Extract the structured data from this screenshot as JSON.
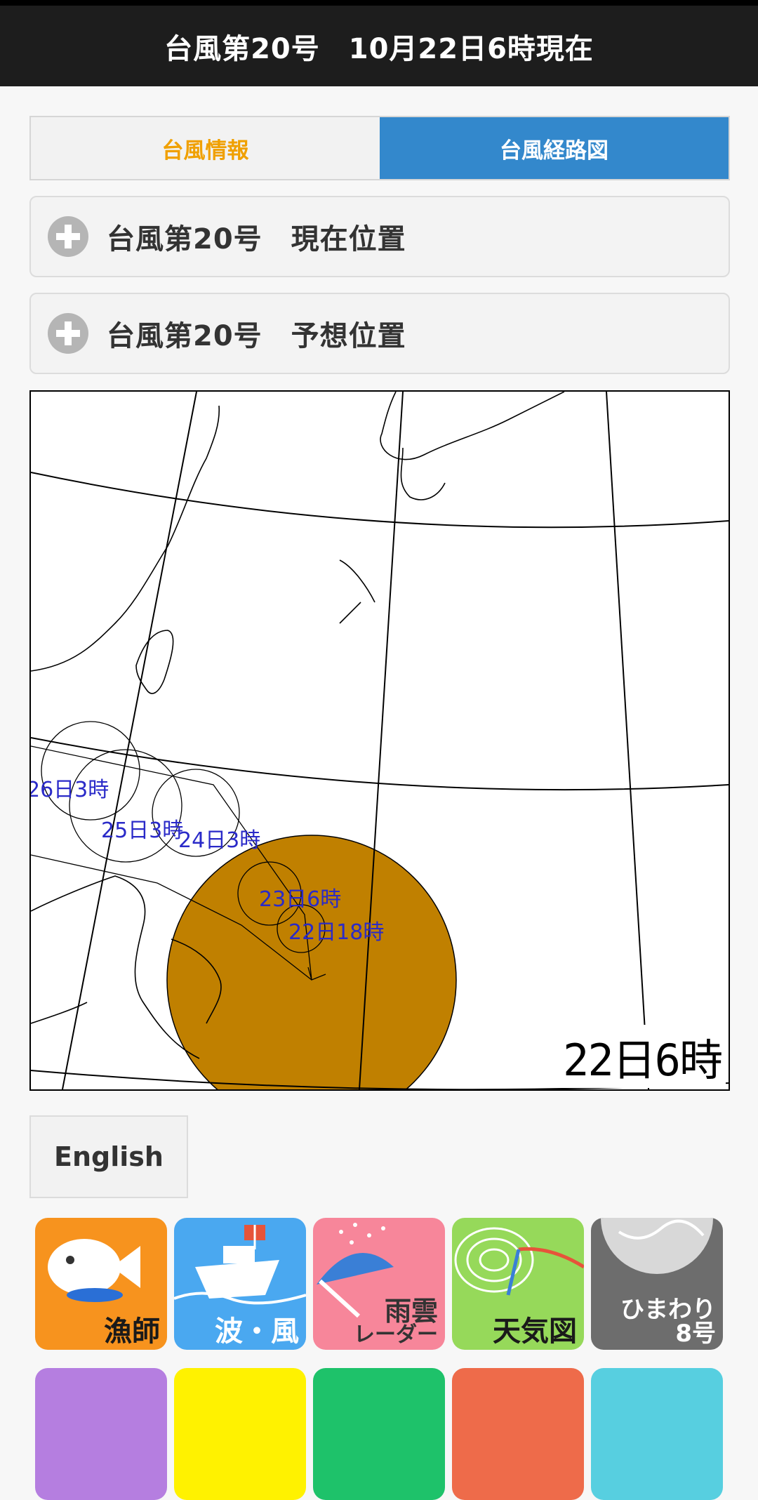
{
  "header": {
    "title": "台風第20号　10月22日6時現在"
  },
  "tabs": [
    {
      "label": "台風情報",
      "active": false
    },
    {
      "label": "台風経路図",
      "active": true
    }
  ],
  "accordions": [
    {
      "label": "台風第20号　現在位置"
    },
    {
      "label": "台風第20号　予想位置"
    }
  ],
  "map": {
    "timestamp": "22日6時",
    "forecast_labels": [
      "26日3時",
      "25日3時",
      "24日3時",
      "23日6時",
      "22日18時"
    ]
  },
  "language_button": {
    "label": "English"
  },
  "apps": [
    {
      "label": "漁師",
      "color": "#f7931e",
      "icon": "fish-icon"
    },
    {
      "label": "波・風",
      "color": "#4aa8f0",
      "icon": "ship-icon"
    },
    {
      "label": "雨雲レーダー",
      "label_line1": "雨雲",
      "label_line2": "レーダー",
      "color": "#f7869a",
      "icon": "umbrella-icon"
    },
    {
      "label": "天気図",
      "color": "#96d95a",
      "icon": "weather-map-icon"
    },
    {
      "label": "ひまわり8号",
      "label_line1": "ひまわり",
      "label_line2": "8号",
      "color": "#6d6d6d",
      "icon": "satellite-earth-icon"
    }
  ],
  "apps_row2_colors": [
    "#b57ee0",
    "#fff200",
    "#1ec26a",
    "#ee6b4a",
    "#57cfe0"
  ]
}
